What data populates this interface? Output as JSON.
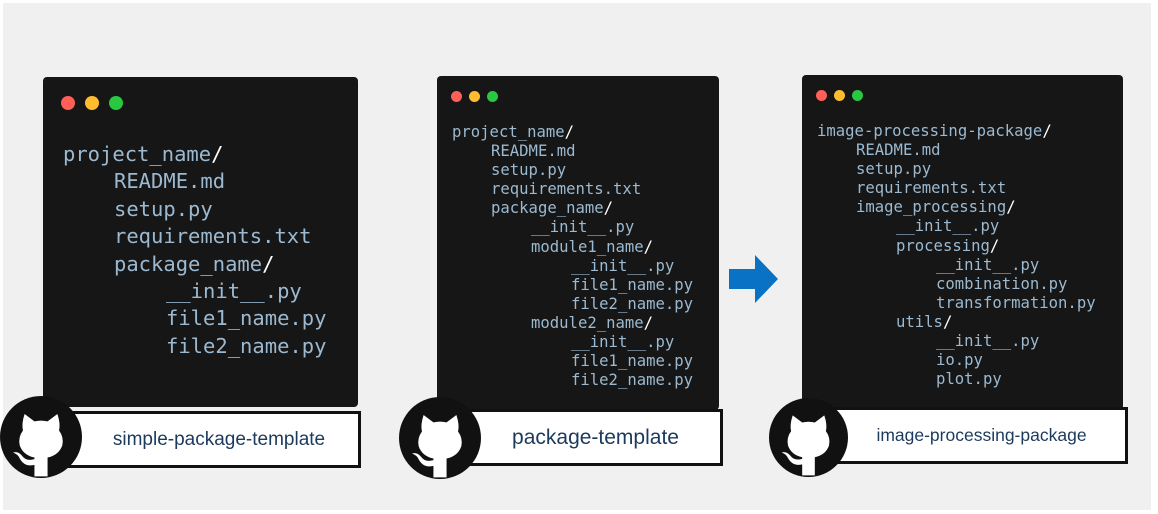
{
  "colors": {
    "background": "#f0f0f0",
    "terminal_bg": "#161616",
    "tree_text": "#9bb9d0",
    "arrow": "#0a72c4",
    "repo_label_text": "#1b3a5c"
  },
  "icons": {
    "repo_logo": "github-octocat-icon",
    "transition": "right-arrow-icon"
  },
  "templates": [
    {
      "repo_name": "simple-package-template",
      "tree": [
        {
          "name": "project_name",
          "slash": "/",
          "depth": 0
        },
        {
          "name": "README.md",
          "slash": "",
          "depth": 1
        },
        {
          "name": "setup.py",
          "slash": "",
          "depth": 1
        },
        {
          "name": "requirements.txt",
          "slash": "",
          "depth": 1
        },
        {
          "name": "package_name",
          "slash": "/",
          "depth": 1
        },
        {
          "name": "__init__.py",
          "slash": "",
          "depth": 2
        },
        {
          "name": "file1_name.py",
          "slash": "",
          "depth": 2
        },
        {
          "name": "file2_name.py",
          "slash": "",
          "depth": 2
        }
      ]
    },
    {
      "repo_name": "package-template",
      "tree": [
        {
          "name": "project_name",
          "slash": "/",
          "depth": 0
        },
        {
          "name": "README.md",
          "slash": "",
          "depth": 1
        },
        {
          "name": "setup.py",
          "slash": "",
          "depth": 1
        },
        {
          "name": "requirements.txt",
          "slash": "",
          "depth": 1
        },
        {
          "name": "package_name",
          "slash": "/",
          "depth": 1
        },
        {
          "name": "__init__.py",
          "slash": "",
          "depth": 2
        },
        {
          "name": "module1_name",
          "slash": "/",
          "depth": 2
        },
        {
          "name": "__init__.py",
          "slash": "",
          "depth": 3
        },
        {
          "name": "file1_name.py",
          "slash": "",
          "depth": 3
        },
        {
          "name": "file2_name.py",
          "slash": "",
          "depth": 3
        },
        {
          "name": "module2_name",
          "slash": "/",
          "depth": 2
        },
        {
          "name": "__init__.py",
          "slash": "",
          "depth": 3
        },
        {
          "name": "file1_name.py",
          "slash": "",
          "depth": 3
        },
        {
          "name": "file2_name.py",
          "slash": "",
          "depth": 3
        }
      ]
    },
    {
      "repo_name": "image-processing-package",
      "tree": [
        {
          "name": "image-processing-package",
          "slash": "/",
          "depth": 0
        },
        {
          "name": "README.md",
          "slash": "",
          "depth": 1
        },
        {
          "name": "setup.py",
          "slash": "",
          "depth": 1
        },
        {
          "name": "requirements.txt",
          "slash": "",
          "depth": 1
        },
        {
          "name": "image_processing",
          "slash": "/",
          "depth": 1
        },
        {
          "name": "__init__.py",
          "slash": "",
          "depth": 2
        },
        {
          "name": "processing",
          "slash": "/",
          "depth": 2
        },
        {
          "name": "__init__.py",
          "slash": "",
          "depth": 3
        },
        {
          "name": "combination.py",
          "slash": "",
          "depth": 3
        },
        {
          "name": "transformation.py",
          "slash": "",
          "depth": 3
        },
        {
          "name": "utils",
          "slash": "/",
          "depth": 2
        },
        {
          "name": "__init__.py",
          "slash": "",
          "depth": 3
        },
        {
          "name": "io.py",
          "slash": "",
          "depth": 3
        },
        {
          "name": "plot.py",
          "slash": "",
          "depth": 3
        }
      ]
    }
  ]
}
